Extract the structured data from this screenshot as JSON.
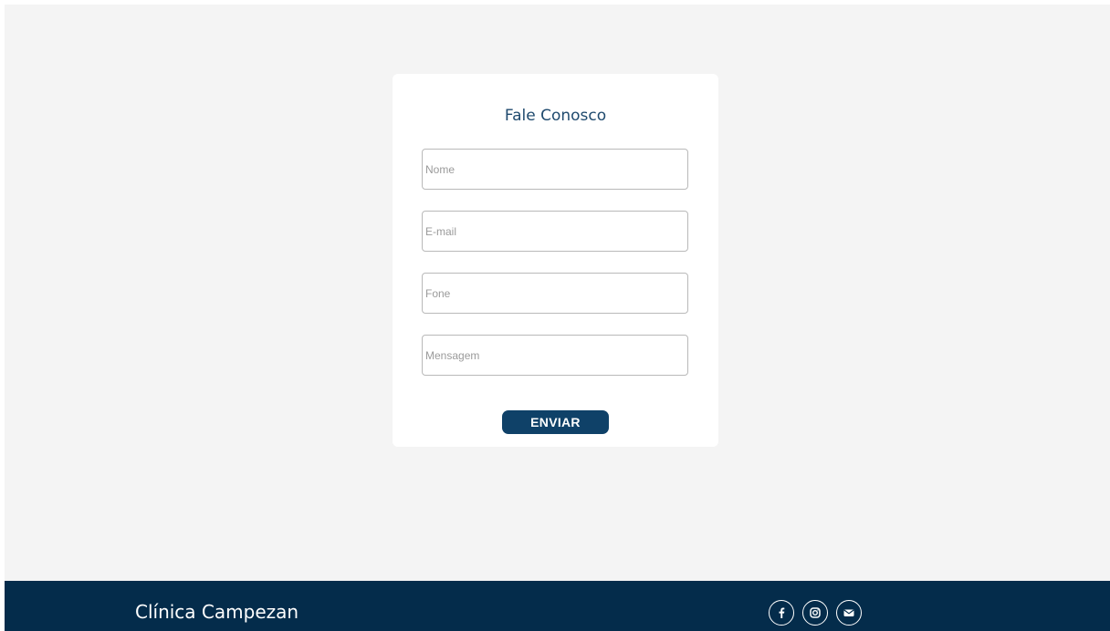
{
  "form": {
    "title": "Fale Conosco",
    "fields": {
      "name_placeholder": "Nome",
      "email_placeholder": "E-mail",
      "phone_placeholder": "Fone",
      "message_placeholder": "Mensagem"
    },
    "submit_label": "ENVIAR"
  },
  "footer": {
    "brand": "Clínica Campezan",
    "social_icons": [
      "facebook-icon",
      "instagram-icon",
      "email-icon"
    ]
  },
  "colors": {
    "page_background": "#f4f4f4",
    "card_background": "#ffffff",
    "title_color": "#1f4a6e",
    "button_background": "#0f4168",
    "footer_background": "#042c4b"
  }
}
